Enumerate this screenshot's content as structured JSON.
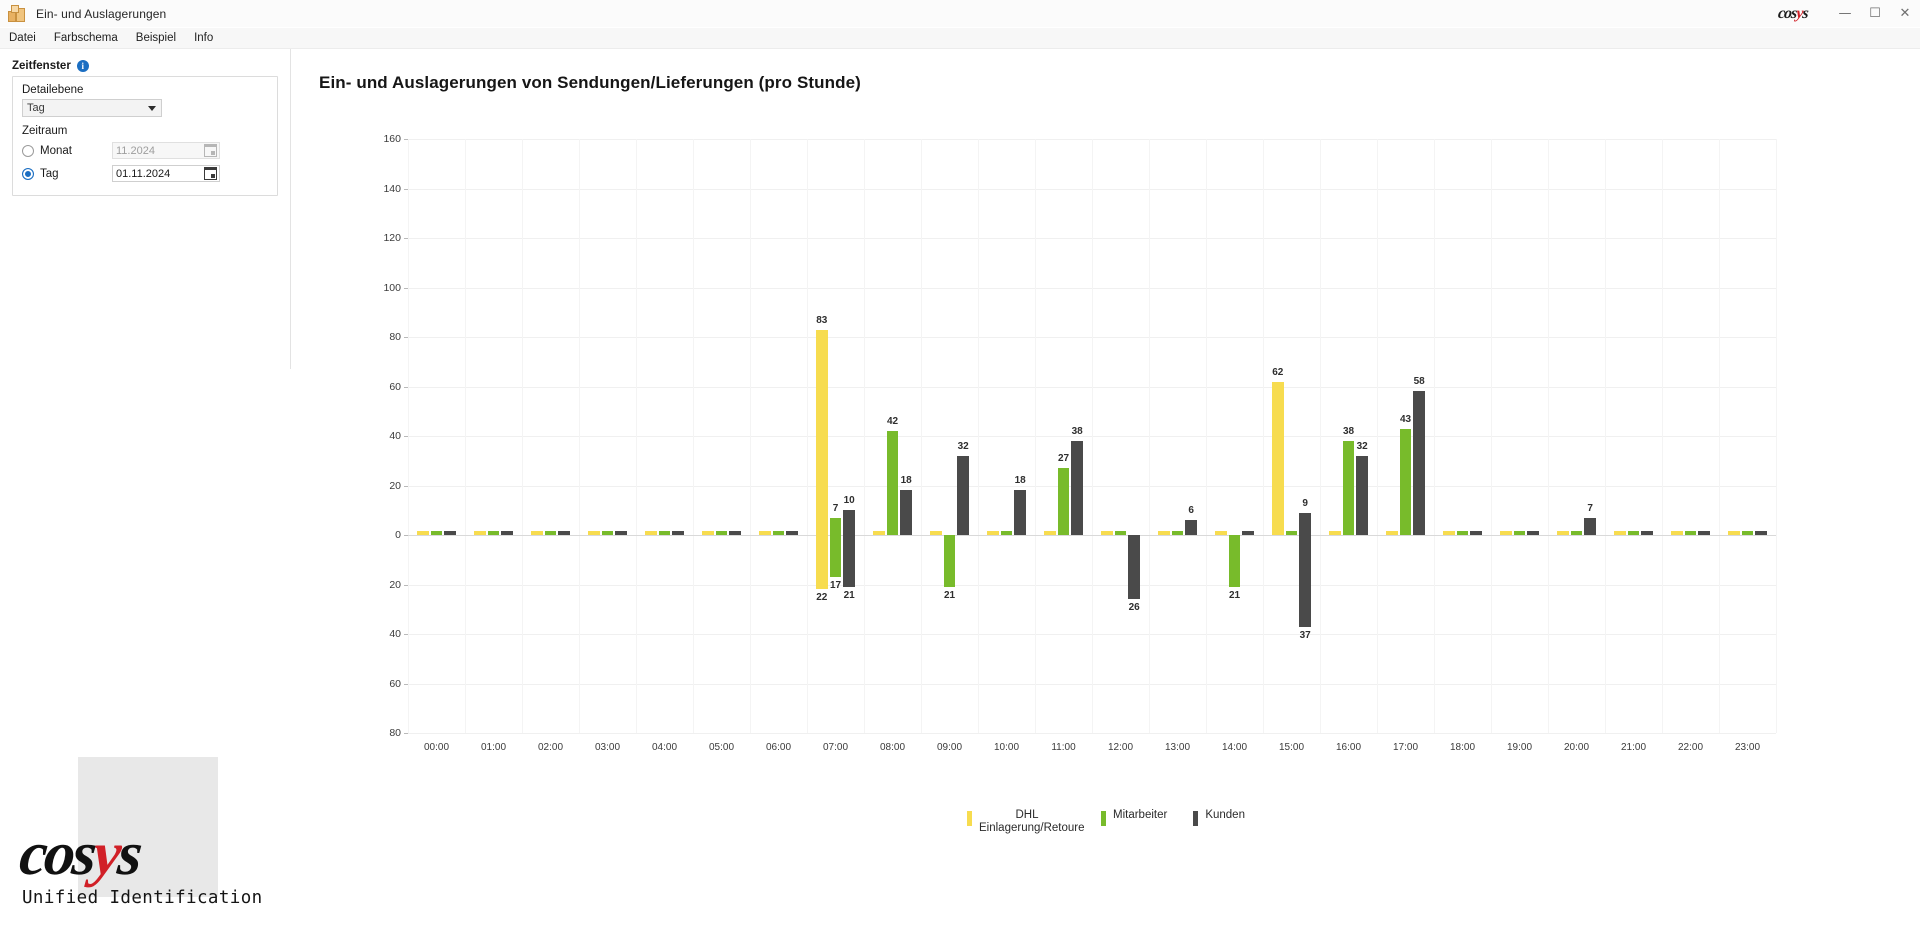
{
  "window": {
    "title": "Ein- und Auslagerungen",
    "app_icon": "boxes-icon",
    "brand_left": "cos",
    "brand_accent": "y",
    "brand_right": "s",
    "minimize": "—",
    "maximize": "☐",
    "close": "✕"
  },
  "menubar": {
    "items": [
      {
        "label": "Datei"
      },
      {
        "label": "Farbschema"
      },
      {
        "label": "Beispiel"
      },
      {
        "label": "Info"
      }
    ]
  },
  "left_panel": {
    "heading": "Zeitfenster",
    "info_badge": "i",
    "detail_level_label": "Detailebene",
    "detail_level_value": "Tag",
    "period_label": "Zeitraum",
    "month_radio_label": "Monat",
    "month_value": "11.2024",
    "day_radio_label": "Tag",
    "day_value": "01.11.2024",
    "selected_radio": "Tag"
  },
  "logo": {
    "text_left": "cos",
    "text_accent": "y",
    "text_right": "s",
    "tagline": "Unified Identification"
  },
  "legend_position": "bottom-center",
  "colors": {
    "dhl": "#F7DC4F",
    "mitarbeiter": "#78BB2B",
    "kunden": "#4A4A4A",
    "grid": "#F0F0F0",
    "axis": "#D9D9D9",
    "accent_blue": "#1B6EC2",
    "brand_red": "#D12027"
  },
  "chart_data": {
    "type": "bar",
    "title": "Ein- und Auslagerungen von Sendungen/Lieferungen (pro Stunde)",
    "xlabel": "",
    "ylabel": "",
    "grid": true,
    "legend_position": "bottom",
    "ylim": [
      -80,
      160
    ],
    "ytick_values": [
      160,
      140,
      120,
      100,
      80,
      60,
      40,
      20,
      0,
      -20,
      -40,
      -60,
      -80
    ],
    "ytick_labels": [
      "160",
      "140",
      "120",
      "100",
      "80",
      "60",
      "40",
      "20",
      "0",
      "20",
      "40",
      "60",
      "80"
    ],
    "categories": [
      "00:00",
      "01:00",
      "02:00",
      "03:00",
      "04:00",
      "05:00",
      "06:00",
      "07:00",
      "08:00",
      "09:00",
      "10:00",
      "11:00",
      "12:00",
      "13:00",
      "14:00",
      "15:00",
      "16:00",
      "17:00",
      "18:00",
      "19:00",
      "20:00",
      "21:00",
      "22:00",
      "23:00"
    ],
    "series": [
      {
        "name": "DHL Einlagerung/Retoure",
        "color": "#F7DC4F",
        "positive": [
          0,
          0,
          0,
          0,
          0,
          0,
          0,
          83,
          0,
          0,
          0,
          0,
          0,
          0,
          0,
          62,
          0,
          0,
          0,
          0,
          0,
          0,
          0,
          0
        ],
        "negative": [
          0,
          0,
          0,
          0,
          0,
          0,
          0,
          -22,
          0,
          0,
          0,
          0,
          0,
          0,
          0,
          0,
          0,
          0,
          0,
          0,
          0,
          0,
          0,
          0
        ]
      },
      {
        "name": "Mitarbeiter",
        "color": "#78BB2B",
        "positive": [
          0,
          0,
          0,
          0,
          0,
          0,
          0,
          7,
          42,
          0,
          0,
          27,
          0,
          0,
          0,
          0,
          38,
          43,
          0,
          0,
          0,
          0,
          0,
          0
        ],
        "negative": [
          0,
          0,
          0,
          0,
          0,
          0,
          0,
          -17,
          0,
          -21,
          0,
          0,
          0,
          0,
          -21,
          0,
          0,
          0,
          0,
          0,
          0,
          0,
          0,
          0
        ]
      },
      {
        "name": "Kunden",
        "color": "#4A4A4A",
        "positive": [
          0,
          0,
          0,
          0,
          0,
          0,
          0,
          10,
          18,
          32,
          18,
          38,
          0,
          6,
          0,
          9,
          32,
          58,
          0,
          0,
          7,
          0,
          0,
          0
        ],
        "negative": [
          0,
          0,
          0,
          0,
          0,
          0,
          0,
          -21,
          0,
          0,
          0,
          0,
          -26,
          0,
          0,
          -37,
          0,
          0,
          0,
          0,
          0,
          0,
          0,
          0
        ]
      }
    ],
    "data_labels": [
      {
        "category": "07:00",
        "series": "DHL Einlagerung/Retoure",
        "value": 83,
        "text": "83",
        "side": "top"
      },
      {
        "category": "07:00",
        "series": "Mitarbeiter",
        "value": 7,
        "text": "7",
        "side": "top"
      },
      {
        "category": "07:00",
        "series": "Kunden",
        "value": 10,
        "text": "10",
        "side": "top"
      },
      {
        "category": "07:00",
        "series": "DHL Einlagerung/Retoure",
        "value": -22,
        "text": "22",
        "side": "bottom"
      },
      {
        "category": "07:00",
        "series": "Mitarbeiter",
        "value": -17,
        "text": "17",
        "side": "bottom"
      },
      {
        "category": "07:00",
        "series": "Kunden",
        "value": -21,
        "text": "21",
        "side": "bottom"
      },
      {
        "category": "08:00",
        "series": "Mitarbeiter",
        "value": 42,
        "text": "42",
        "side": "top"
      },
      {
        "category": "08:00",
        "series": "Kunden",
        "value": 18,
        "text": "18",
        "side": "top"
      },
      {
        "category": "09:00",
        "series": "Kunden",
        "value": 32,
        "text": "32",
        "side": "top"
      },
      {
        "category": "09:00",
        "series": "Mitarbeiter",
        "value": -21,
        "text": "21",
        "side": "bottom"
      },
      {
        "category": "10:00",
        "series": "Kunden",
        "value": 18,
        "text": "18",
        "side": "top"
      },
      {
        "category": "11:00",
        "series": "Mitarbeiter",
        "value": 27,
        "text": "27",
        "side": "top"
      },
      {
        "category": "11:00",
        "series": "Kunden",
        "value": 38,
        "text": "38",
        "side": "top"
      },
      {
        "category": "12:00",
        "series": "Kunden",
        "value": -26,
        "text": "26",
        "side": "bottom"
      },
      {
        "category": "13:00",
        "series": "Kunden",
        "value": 6,
        "text": "6",
        "side": "top"
      },
      {
        "category": "14:00",
        "series": "Mitarbeiter",
        "value": -21,
        "text": "21",
        "side": "bottom"
      },
      {
        "category": "15:00",
        "series": "DHL Einlagerung/Retoure",
        "value": 62,
        "text": "62",
        "side": "top"
      },
      {
        "category": "15:00",
        "series": "Kunden",
        "value": 9,
        "text": "9",
        "side": "top"
      },
      {
        "category": "15:00",
        "series": "Kunden",
        "value": -37,
        "text": "37",
        "side": "bottom"
      },
      {
        "category": "16:00",
        "series": "Mitarbeiter",
        "value": 38,
        "text": "38",
        "side": "top"
      },
      {
        "category": "16:00",
        "series": "Kunden",
        "value": 32,
        "text": "32",
        "side": "top"
      },
      {
        "category": "17:00",
        "series": "Mitarbeiter",
        "value": 43,
        "text": "43",
        "side": "top"
      },
      {
        "category": "17:00",
        "series": "Kunden",
        "value": 58,
        "text": "58",
        "side": "top"
      },
      {
        "category": "20:00",
        "series": "Kunden",
        "value": 7,
        "text": "7",
        "side": "top"
      }
    ]
  }
}
